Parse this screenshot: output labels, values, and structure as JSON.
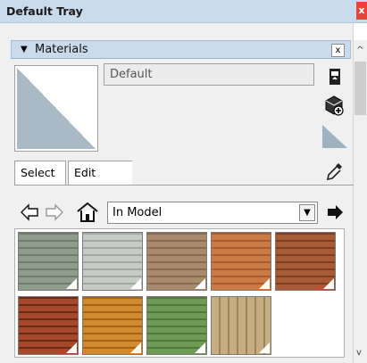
{
  "window": {
    "title": "Default Tray",
    "close_label": "x"
  },
  "materials": {
    "header_label": "Materials",
    "collapse_glyph": "▼",
    "close_label": "x",
    "name_value": "Default"
  },
  "tabs": [
    {
      "label": "Select",
      "active": true
    },
    {
      "label": "Edit",
      "active": false
    }
  ],
  "browser": {
    "dropdown_value": "In Model",
    "dropdown_arrow": "▼"
  },
  "icons": {
    "sample_paint": "eyedropper-icon",
    "back": "arrow-left-icon",
    "forward": "arrow-right-icon",
    "home": "home-icon",
    "details": "arrow-right-filled-icon",
    "create_material": "create-material-icon",
    "display_secondary": "secondary-pane-icon",
    "default_material": "default-material-icon"
  },
  "swatches": [
    {
      "name": "gray-green-siding",
      "base": "#8f9c8b",
      "line": "#6f7c6c"
    },
    {
      "name": "light-gray-siding",
      "base": "#c7cbc6",
      "line": "#a2a8a2"
    },
    {
      "name": "tan-siding",
      "base": "#a88a6c",
      "line": "#8a6c52"
    },
    {
      "name": "orange-wood",
      "base": "#cc7a45",
      "line": "#a95c30"
    },
    {
      "name": "brown-wood",
      "base": "#a65b34",
      "line": "#7d3f20"
    },
    {
      "name": "dark-red-wood",
      "base": "#a5492a",
      "line": "#6f2a16"
    },
    {
      "name": "amber-wood",
      "base": "#d28a2f",
      "line": "#a86218"
    },
    {
      "name": "green-siding",
      "base": "#6f9a55",
      "line": "#4f7a3a"
    },
    {
      "name": "bamboo",
      "base": "#c7ad82",
      "line": "#9c8358"
    }
  ]
}
